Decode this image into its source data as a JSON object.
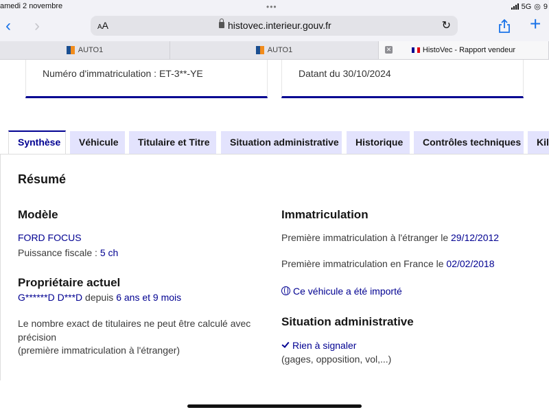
{
  "status_bar": {
    "date": "amedi 2 novembre",
    "dots": "•••",
    "network": "5G",
    "battery_partial": "9"
  },
  "browser": {
    "aa_label": "AA",
    "url": "histovec.interieur.gouv.fr",
    "icons": [
      "chevron-left-icon",
      "chevron-right-icon",
      "lock-icon",
      "reload-icon",
      "share-icon",
      "plus-icon"
    ],
    "tabs": [
      {
        "label": "AUTO1",
        "active": false
      },
      {
        "label": "AUTO1",
        "active": false
      },
      {
        "label": "HistoVec - Rapport vendeur",
        "active": true
      }
    ],
    "accent": "#1a73e8"
  },
  "cards": {
    "registration": "Numéro d'immatriculation : ET-3**-YE",
    "date": "Datant du 30/10/2024"
  },
  "content_tabs": [
    {
      "label": "Synthèse",
      "active": true
    },
    {
      "label": "Véhicule",
      "active": false
    },
    {
      "label": "Titulaire et Titre",
      "active": false
    },
    {
      "label": "Situation administrative",
      "active": false
    },
    {
      "label": "Historique",
      "active": false
    },
    {
      "label": "Contrôles techniques",
      "active": false
    },
    {
      "label": "Kilo",
      "active": false
    }
  ],
  "summary": {
    "title": "Résumé",
    "model": {
      "heading": "Modèle",
      "name": "FORD FOCUS",
      "fiscal_label": "Puissance fiscale : ",
      "fiscal_value": "5 ch"
    },
    "owner": {
      "heading": "Propriétaire actuel",
      "name": "G******D D***D",
      "since_label": " depuis ",
      "since_value": "6 ans et 9 mois",
      "note_line1": "Le nombre exact de titulaires ne peut être calculé avec",
      "note_line2": "précision",
      "note_line3": "(première immatriculation à l'étranger)"
    },
    "registration": {
      "heading": "Immatriculation",
      "foreign_label": "Première immatriculation à l'étranger le ",
      "foreign_date": "29/12/2012",
      "france_label": "Première immatriculation en France le ",
      "france_date": "02/02/2018",
      "imported": "Ce véhicule a été importé"
    },
    "admin": {
      "heading": "Situation administrative",
      "status": "Rien à signaler",
      "details": "(gages, opposition, vol,...)"
    }
  },
  "colors": {
    "primary": "#000091",
    "tab_bg": "#e3e3fd",
    "text": "#161616"
  }
}
